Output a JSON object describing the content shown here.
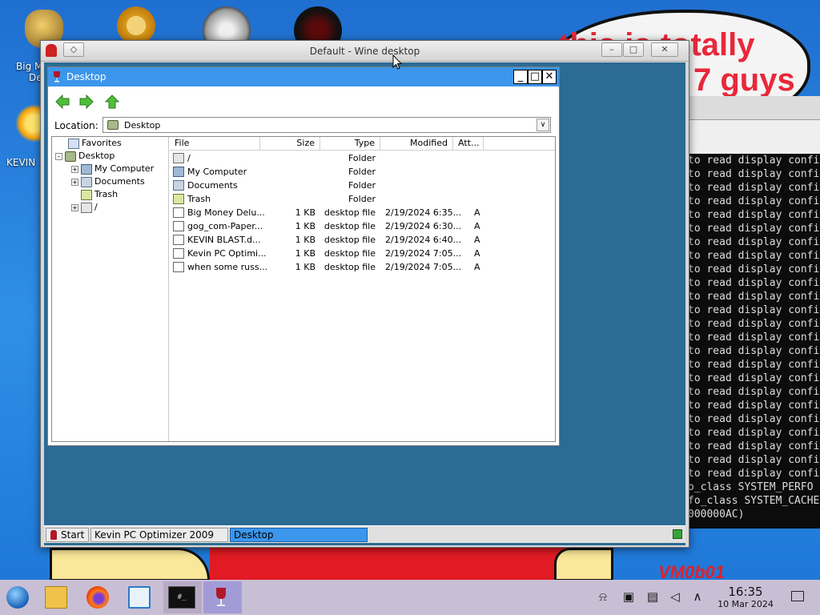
{
  "desktop": {
    "icons": [
      {
        "label": "Big M",
        "label2": "De"
      },
      {
        "label": "KEVIN"
      }
    ],
    "meme": {
      "line1": "this is totally",
      "line2": "7 guys",
      "watermark": "VM0b01"
    }
  },
  "terminal": {
    "lines": [
      "to read display confi",
      "to read display confi",
      "to read display confi",
      "to read display confi",
      "to read display confi",
      "to read display confi",
      "to read display confi",
      "to read display confi",
      "to read display confi",
      "to read display confi",
      "to read display confi",
      "to read display confi",
      "to read display confi",
      "to read display confi",
      "to read display confi",
      "to read display confi",
      "to read display confi",
      "to read display confi",
      "to read display confi",
      "to read display confi",
      "to read display confi",
      "to read display confi",
      "to read display confi",
      "to read display confi",
      "o_class SYSTEM_PERFO",
      "fo_class SYSTEM_CACHE",
      "000000AC)"
    ]
  },
  "wine_window": {
    "title": "Default - Wine desktop",
    "taskbar": {
      "start": "Start",
      "item1": "Kevin PC Optimizer 2009",
      "item2": "Desktop"
    }
  },
  "explorer": {
    "title": "Desktop",
    "location_label": "Location:",
    "location_value": "Desktop",
    "tree": {
      "favorites": "Favorites",
      "desktop": "Desktop",
      "my_computer": "My Computer",
      "documents": "Documents",
      "trash": "Trash",
      "root": "/"
    },
    "columns": {
      "file": "File",
      "size": "Size",
      "type": "Type",
      "modified": "Modified",
      "attr": "Att..."
    },
    "rows": [
      {
        "name": "/",
        "size": "",
        "type": "Folder",
        "modified": "",
        "attr": "",
        "icon": "drive-icon"
      },
      {
        "name": "My Computer",
        "size": "",
        "type": "Folder",
        "modified": "",
        "attr": "",
        "icon": "computer-icon"
      },
      {
        "name": "Documents",
        "size": "",
        "type": "Folder",
        "modified": "",
        "attr": "",
        "icon": "documents-icon"
      },
      {
        "name": "Trash",
        "size": "",
        "type": "Folder",
        "modified": "",
        "attr": "",
        "icon": "trash-icon"
      },
      {
        "name": "Big Money Delu...",
        "size": "1 KB",
        "type": "desktop file",
        "modified": "2/19/2024 6:35...",
        "attr": "A",
        "icon": "file-icon"
      },
      {
        "name": "gog_com-Paper...",
        "size": "1 KB",
        "type": "desktop file",
        "modified": "2/19/2024 6:30...",
        "attr": "A",
        "icon": "file-icon"
      },
      {
        "name": "KEVIN BLAST.d...",
        "size": "1 KB",
        "type": "desktop file",
        "modified": "2/19/2024 6:40...",
        "attr": "A",
        "icon": "file-icon"
      },
      {
        "name": "Kevin PC Optimi...",
        "size": "1 KB",
        "type": "desktop file",
        "modified": "2/19/2024 7:05...",
        "attr": "A",
        "icon": "file-icon"
      },
      {
        "name": "when some russ...",
        "size": "1 KB",
        "type": "desktop file",
        "modified": "2/19/2024 7:05...",
        "attr": "A",
        "icon": "file-icon"
      }
    ]
  },
  "host_taskbar": {
    "time": "16:35",
    "date": "10 Mar 2024",
    "terminal_label": "#_"
  },
  "colors": {
    "explorer_title": "#3c96ec",
    "wine_inner": "#2b6b94",
    "selected_task": "#3c96ec"
  }
}
